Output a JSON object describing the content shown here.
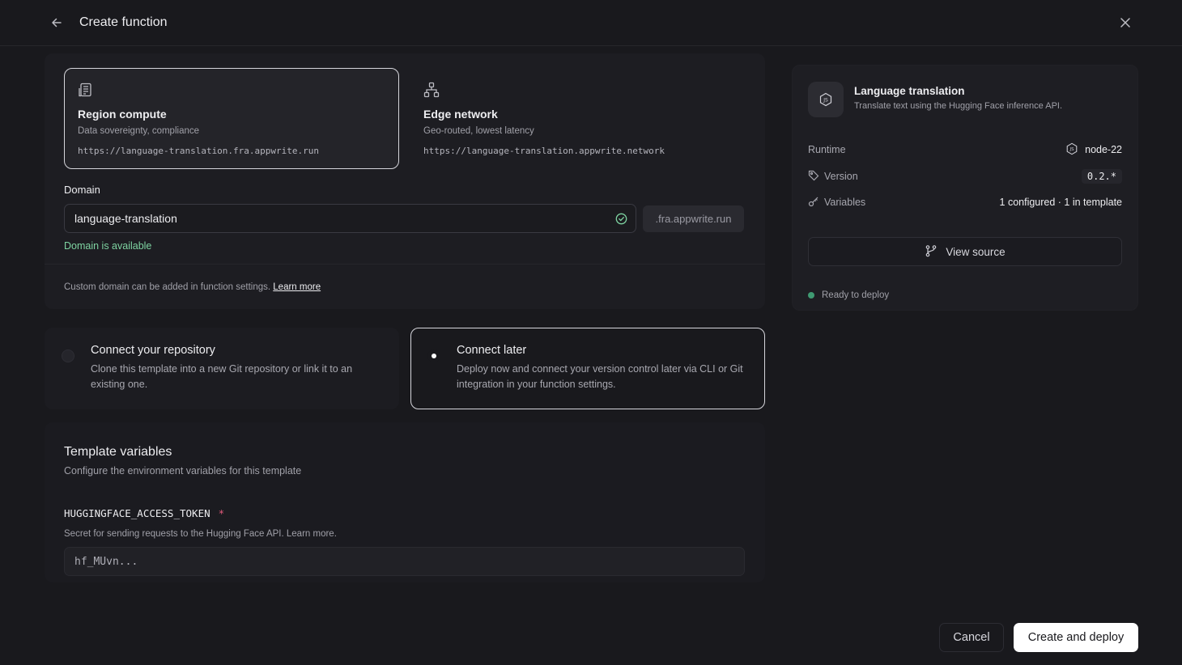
{
  "header": {
    "title": "Create function"
  },
  "deployment": {
    "options": [
      {
        "title": "Region compute",
        "subtitle": "Data sovereignty, compliance",
        "url": "https://language-translation.fra.appwrite.run",
        "icon": "server-icon",
        "selected": true
      },
      {
        "title": "Edge network",
        "subtitle": "Geo-routed, lowest latency",
        "url": "https://language-translation.appwrite.network",
        "icon": "network-icon",
        "selected": false
      }
    ],
    "domain": {
      "label": "Domain",
      "value": "language-translation",
      "suffix": ".fra.appwrite.run",
      "status": "Domain is available"
    },
    "note": {
      "text": "Custom domain can be added in function settings.",
      "link": "Learn more"
    }
  },
  "repository": {
    "options": [
      {
        "title": "Connect your repository",
        "description": "Clone this template into a new Git repository or link it to an existing one.",
        "selected": false
      },
      {
        "title": "Connect later",
        "description": "Deploy now and connect your version control later via CLI or Git integration in your function settings.",
        "selected": true
      }
    ]
  },
  "variables": {
    "title": "Template variables",
    "subtitle": "Configure the environment variables for this template",
    "items": [
      {
        "name": "HUGGINGFACE_ACCESS_TOKEN",
        "required_mark": "*",
        "description": "Secret for sending requests to the Hugging Face API. Learn more.",
        "value": "hf_MUvn..."
      }
    ]
  },
  "summary": {
    "template_name": "Language translation",
    "template_description": "Translate text using the Hugging Face inference API.",
    "runtime_label": "Runtime",
    "runtime_value": "node-22",
    "version_label": "Version",
    "version_value": "0.2.*",
    "variables_label": "Variables",
    "variables_value": "1 configured · 1 in template",
    "view_source": "View source",
    "status": "Ready to deploy"
  },
  "footer": {
    "cancel": "Cancel",
    "submit": "Create and deploy"
  },
  "colors": {
    "background": "#19191d",
    "success": "#7ed3a1",
    "status_dot": "#3f9a72",
    "required": "#e05a7b"
  }
}
